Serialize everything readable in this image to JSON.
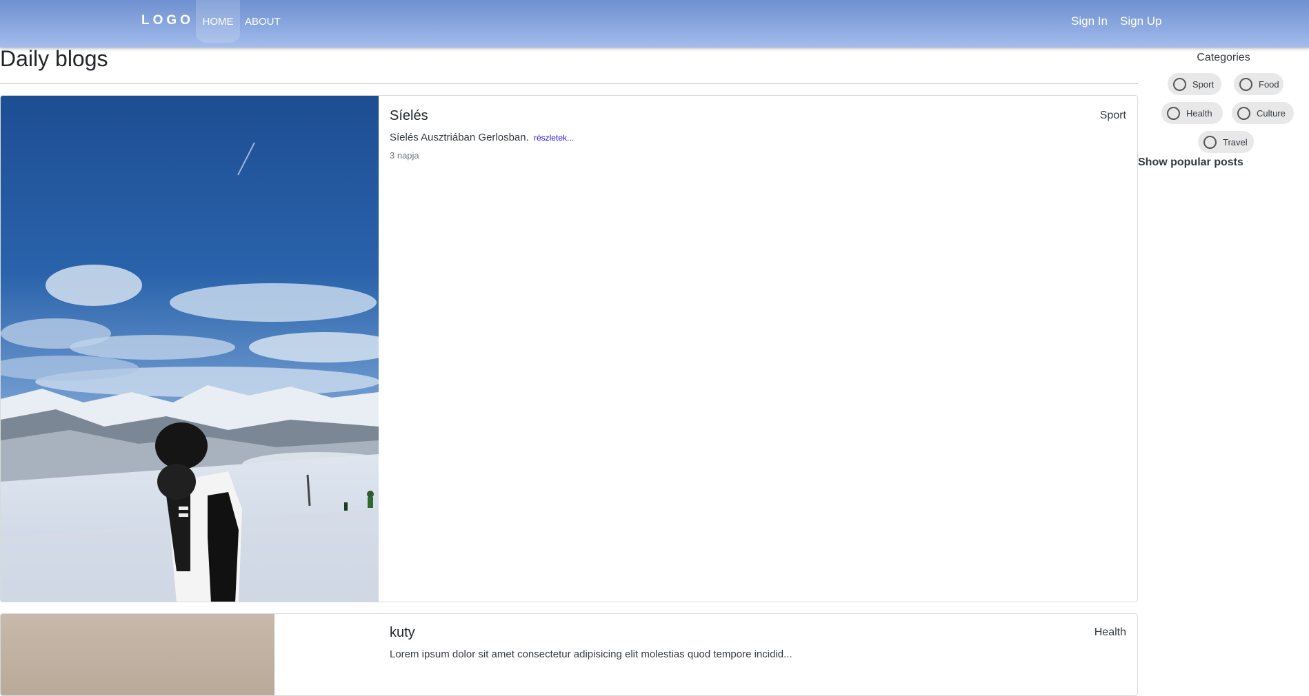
{
  "nav": {
    "logo": "LOGO",
    "home": "HOME",
    "about": "ABOUT",
    "sign_in": "Sign In",
    "sign_up": "Sign Up"
  },
  "main": {
    "title": "Daily blogs",
    "posts": [
      {
        "title": "Síelés",
        "category": "Sport",
        "excerpt": "Síelés Ausztriában Gerlosban.",
        "more": "részletek...",
        "age": "3 napja"
      },
      {
        "title": "kuty",
        "category": "Health",
        "excerpt": "Lorem ipsum dolor sit amet consectetur adipisicing elit molestias quod tempore incidid..."
      }
    ]
  },
  "sidebar": {
    "title": "Categories",
    "categories": [
      "Sport",
      "Food",
      "Health",
      "Culture",
      "Travel"
    ],
    "show_popular": "Show popular posts"
  },
  "colors": {
    "nav_gradient_top": "#6f91cf",
    "nav_gradient_bottom": "#a4bdea",
    "link": "#1a0dff",
    "chip_bg": "#e8e8e8"
  }
}
